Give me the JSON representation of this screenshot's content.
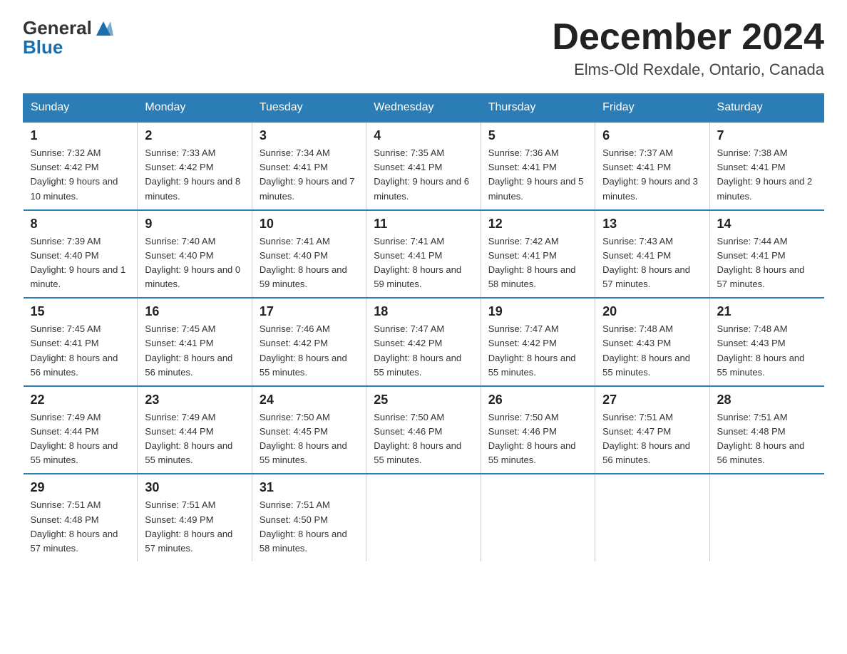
{
  "header": {
    "logo_general": "General",
    "logo_blue": "Blue",
    "title": "December 2024",
    "subtitle": "Elms-Old Rexdale, Ontario, Canada"
  },
  "calendar": {
    "days_of_week": [
      "Sunday",
      "Monday",
      "Tuesday",
      "Wednesday",
      "Thursday",
      "Friday",
      "Saturday"
    ],
    "weeks": [
      [
        {
          "day": "1",
          "sunrise": "7:32 AM",
          "sunset": "4:42 PM",
          "daylight": "9 hours and 10 minutes."
        },
        {
          "day": "2",
          "sunrise": "7:33 AM",
          "sunset": "4:42 PM",
          "daylight": "9 hours and 8 minutes."
        },
        {
          "day": "3",
          "sunrise": "7:34 AM",
          "sunset": "4:41 PM",
          "daylight": "9 hours and 7 minutes."
        },
        {
          "day": "4",
          "sunrise": "7:35 AM",
          "sunset": "4:41 PM",
          "daylight": "9 hours and 6 minutes."
        },
        {
          "day": "5",
          "sunrise": "7:36 AM",
          "sunset": "4:41 PM",
          "daylight": "9 hours and 5 minutes."
        },
        {
          "day": "6",
          "sunrise": "7:37 AM",
          "sunset": "4:41 PM",
          "daylight": "9 hours and 3 minutes."
        },
        {
          "day": "7",
          "sunrise": "7:38 AM",
          "sunset": "4:41 PM",
          "daylight": "9 hours and 2 minutes."
        }
      ],
      [
        {
          "day": "8",
          "sunrise": "7:39 AM",
          "sunset": "4:40 PM",
          "daylight": "9 hours and 1 minute."
        },
        {
          "day": "9",
          "sunrise": "7:40 AM",
          "sunset": "4:40 PM",
          "daylight": "9 hours and 0 minutes."
        },
        {
          "day": "10",
          "sunrise": "7:41 AM",
          "sunset": "4:40 PM",
          "daylight": "8 hours and 59 minutes."
        },
        {
          "day": "11",
          "sunrise": "7:41 AM",
          "sunset": "4:41 PM",
          "daylight": "8 hours and 59 minutes."
        },
        {
          "day": "12",
          "sunrise": "7:42 AM",
          "sunset": "4:41 PM",
          "daylight": "8 hours and 58 minutes."
        },
        {
          "day": "13",
          "sunrise": "7:43 AM",
          "sunset": "4:41 PM",
          "daylight": "8 hours and 57 minutes."
        },
        {
          "day": "14",
          "sunrise": "7:44 AM",
          "sunset": "4:41 PM",
          "daylight": "8 hours and 57 minutes."
        }
      ],
      [
        {
          "day": "15",
          "sunrise": "7:45 AM",
          "sunset": "4:41 PM",
          "daylight": "8 hours and 56 minutes."
        },
        {
          "day": "16",
          "sunrise": "7:45 AM",
          "sunset": "4:41 PM",
          "daylight": "8 hours and 56 minutes."
        },
        {
          "day": "17",
          "sunrise": "7:46 AM",
          "sunset": "4:42 PM",
          "daylight": "8 hours and 55 minutes."
        },
        {
          "day": "18",
          "sunrise": "7:47 AM",
          "sunset": "4:42 PM",
          "daylight": "8 hours and 55 minutes."
        },
        {
          "day": "19",
          "sunrise": "7:47 AM",
          "sunset": "4:42 PM",
          "daylight": "8 hours and 55 minutes."
        },
        {
          "day": "20",
          "sunrise": "7:48 AM",
          "sunset": "4:43 PM",
          "daylight": "8 hours and 55 minutes."
        },
        {
          "day": "21",
          "sunrise": "7:48 AM",
          "sunset": "4:43 PM",
          "daylight": "8 hours and 55 minutes."
        }
      ],
      [
        {
          "day": "22",
          "sunrise": "7:49 AM",
          "sunset": "4:44 PM",
          "daylight": "8 hours and 55 minutes."
        },
        {
          "day": "23",
          "sunrise": "7:49 AM",
          "sunset": "4:44 PM",
          "daylight": "8 hours and 55 minutes."
        },
        {
          "day": "24",
          "sunrise": "7:50 AM",
          "sunset": "4:45 PM",
          "daylight": "8 hours and 55 minutes."
        },
        {
          "day": "25",
          "sunrise": "7:50 AM",
          "sunset": "4:46 PM",
          "daylight": "8 hours and 55 minutes."
        },
        {
          "day": "26",
          "sunrise": "7:50 AM",
          "sunset": "4:46 PM",
          "daylight": "8 hours and 55 minutes."
        },
        {
          "day": "27",
          "sunrise": "7:51 AM",
          "sunset": "4:47 PM",
          "daylight": "8 hours and 56 minutes."
        },
        {
          "day": "28",
          "sunrise": "7:51 AM",
          "sunset": "4:48 PM",
          "daylight": "8 hours and 56 minutes."
        }
      ],
      [
        {
          "day": "29",
          "sunrise": "7:51 AM",
          "sunset": "4:48 PM",
          "daylight": "8 hours and 57 minutes."
        },
        {
          "day": "30",
          "sunrise": "7:51 AM",
          "sunset": "4:49 PM",
          "daylight": "8 hours and 57 minutes."
        },
        {
          "day": "31",
          "sunrise": "7:51 AM",
          "sunset": "4:50 PM",
          "daylight": "8 hours and 58 minutes."
        },
        {
          "day": "",
          "sunrise": "",
          "sunset": "",
          "daylight": ""
        },
        {
          "day": "",
          "sunrise": "",
          "sunset": "",
          "daylight": ""
        },
        {
          "day": "",
          "sunrise": "",
          "sunset": "",
          "daylight": ""
        },
        {
          "day": "",
          "sunrise": "",
          "sunset": "",
          "daylight": ""
        }
      ]
    ]
  }
}
